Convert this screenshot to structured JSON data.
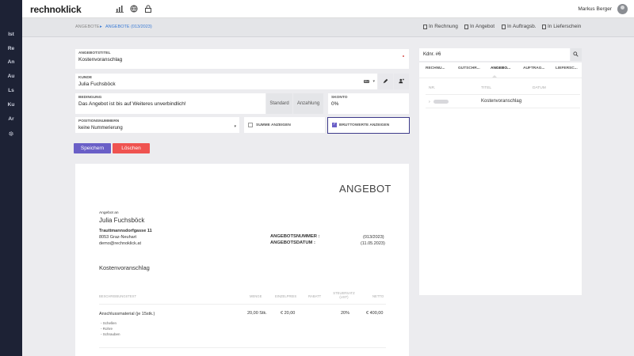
{
  "app": {
    "logo": "rechnoklick",
    "user_name": "Markus Berger"
  },
  "sidebar": {
    "items": [
      "Ist",
      "Re",
      "An",
      "Au",
      "Ls",
      "Ku",
      "Ar"
    ]
  },
  "breadcrumb": {
    "parent": "ANGEBOTE",
    "separator": "▸",
    "current": "ANGEBOTE (013/2023)"
  },
  "actions": {
    "in_rechnung": "In Rechnung",
    "in_angebot": "In Angebot",
    "in_auftrag": "In Auftragsb.",
    "in_lieferschein": "In Lieferschein"
  },
  "form": {
    "title_label": "ANGEBOTSTITEL",
    "title_value": "Kostenvoranschlag",
    "kunde_label": "KUNDE",
    "kunde_value": "Julia Fuchsböck",
    "kunde_badge": "KU",
    "bedingung_label": "BEDINGUNG",
    "bedingung_value": "Das Angebot ist bis auf Weiteres unverbindlich!",
    "seg_standard": "Standard",
    "seg_anzahlung": "Anzahlung",
    "skonto_label": "SKONTO",
    "skonto_value": "0%",
    "positions_label": "POSITIONSNUMMERN",
    "positions_value": "keine Nummerierung",
    "summe_label": "SUMME ANZEIGEN",
    "brutto_label": "BRUTTOWERTE ANZEIGEN",
    "save_label": "Speichern",
    "delete_label": "Löschen"
  },
  "document": {
    "heading": "ANGEBOT",
    "to_label": "Angebot an",
    "customer": "Julia Fuchsböck",
    "street": "Trauttmannsdorfgasse 11",
    "city": "8053 Graz-Neuhart",
    "email": "demo@rechnoklick.at",
    "nr_label": "ANGEBOTSNUMMER :",
    "nr_value": "(013/2023)",
    "date_label": "ANGEBOTSDATUM :",
    "date_value": "(11.05.2023)",
    "subject": "Kostenvoranschlag",
    "columns": {
      "desc": "BESCHREIBUNGSTEXT",
      "menge": "MENGE",
      "einzel": "EINZELPREIS",
      "rabatt": "RABATT",
      "steuer": "STEUERSATZ (UST)",
      "netto": "NETTO"
    },
    "rows": [
      {
        "desc": "Anschlussmaterial (je 15stk.)",
        "menge": "20,00 Stk.",
        "einzel": "€ 20,00",
        "steuer": "20%",
        "netto": "€ 400,00",
        "sub": [
          "- Schellen",
          "- Rohre",
          "- Schrauben"
        ]
      }
    ]
  },
  "panel": {
    "search_value": "Kdnr. #6",
    "tabs": [
      "RECHNU...",
      "GUTSCHR...",
      "ANGEBO...",
      "AUFTRAG...",
      "LIEFERSC..."
    ],
    "col_nr": "NR.",
    "col_titel": "TITEL",
    "col_datum": "DATUM",
    "row_titel": "Kostenvoranschlag"
  },
  "colors": {
    "accent_purple": "#6a5fc7",
    "delete_red": "#ef5350",
    "sidebar_bg": "#1d2235",
    "link_blue": "#3a7bd5"
  }
}
